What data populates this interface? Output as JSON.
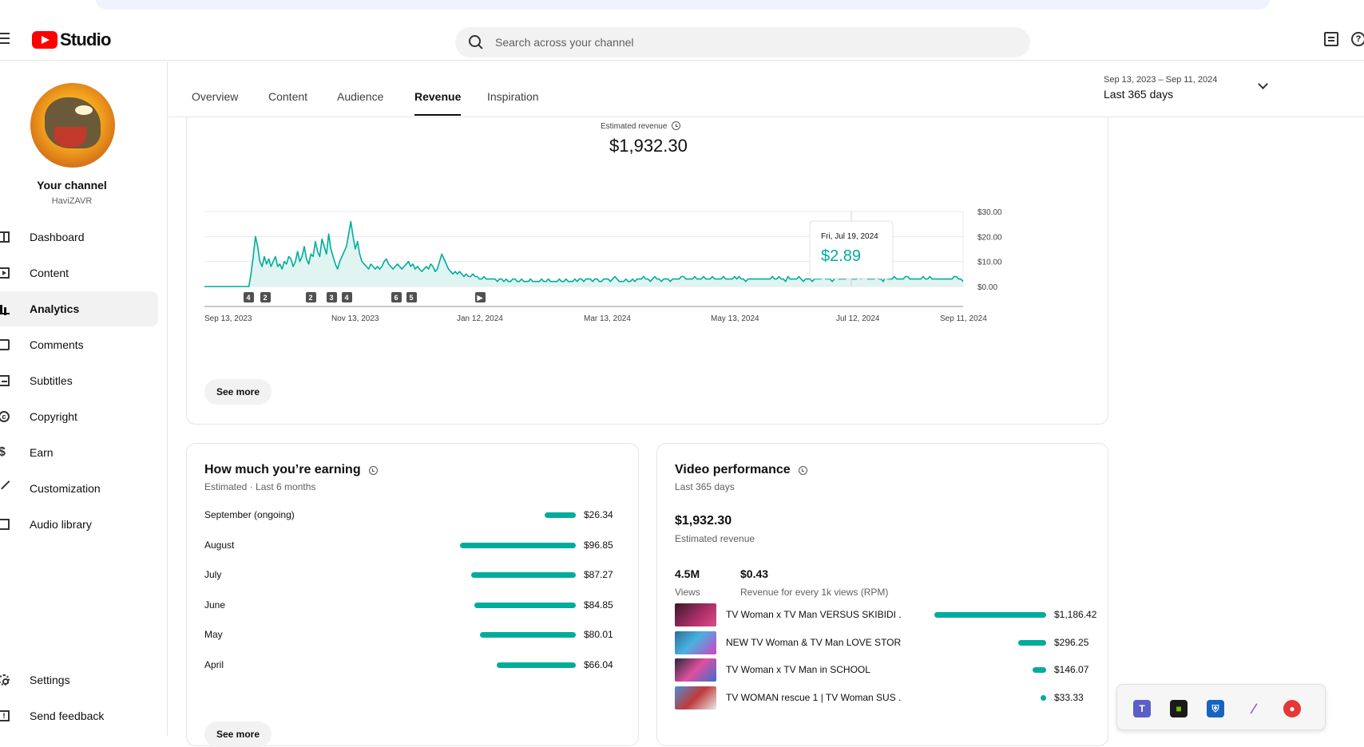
{
  "header": {
    "logo_text": "Studio",
    "search_placeholder": "Search across your channel"
  },
  "sidebar": {
    "channel_label": "Your channel",
    "channel_handle": "HaviZAVR",
    "items": [
      {
        "label": "Dashboard",
        "icon": "dashboard-icon"
      },
      {
        "label": "Content",
        "icon": "content-icon"
      },
      {
        "label": "Analytics",
        "icon": "analytics-icon",
        "active": true
      },
      {
        "label": "Comments",
        "icon": "comments-icon"
      },
      {
        "label": "Subtitles",
        "icon": "subtitles-icon"
      },
      {
        "label": "Copyright",
        "icon": "copyright-icon"
      },
      {
        "label": "Earn",
        "icon": "earn-icon"
      },
      {
        "label": "Customization",
        "icon": "customization-icon"
      },
      {
        "label": "Audio library",
        "icon": "audio-library-icon"
      }
    ],
    "bottom_items": [
      {
        "label": "Settings",
        "icon": "settings-icon"
      },
      {
        "label": "Send feedback",
        "icon": "feedback-icon"
      }
    ]
  },
  "tabs": [
    {
      "label": "Overview"
    },
    {
      "label": "Content"
    },
    {
      "label": "Audience"
    },
    {
      "label": "Revenue",
      "active": true
    },
    {
      "label": "Inspiration"
    }
  ],
  "date_range": {
    "range": "Sep 13, 2023 – Sep 11, 2024",
    "preset": "Last 365 days"
  },
  "revenue_card": {
    "label": "Estimated revenue",
    "value": "$1,932.30",
    "see_more": "See more",
    "tooltip_date": "Fri, Jul 19, 2024",
    "tooltip_value": "$2.89",
    "markers": [
      "4",
      "2",
      "2",
      "3",
      "4",
      "6",
      "5",
      "▶"
    ]
  },
  "chart_data": {
    "type": "area",
    "x_ticks": [
      "Sep 13, 2023",
      "Nov 13, 2023",
      "Jan 12, 2024",
      "Mar 13, 2024",
      "May 13, 2024",
      "Jul 12, 2024",
      "Sep 11, 2024"
    ],
    "y_ticks": [
      "$30.00",
      "$20.00",
      "$10.00",
      "$0.00"
    ],
    "ylim": [
      0,
      30
    ],
    "color": "#00ac9c",
    "values": [
      0,
      0,
      0,
      0,
      0,
      0,
      0,
      0,
      0,
      0,
      0,
      0,
      0,
      0,
      0,
      0,
      0,
      0,
      0,
      0,
      0,
      5,
      12,
      20,
      16,
      10,
      8,
      12,
      9,
      11,
      8,
      10,
      12,
      8,
      9,
      7,
      10,
      9,
      12,
      11,
      8,
      10,
      14,
      10,
      12,
      16,
      11,
      9,
      13,
      12,
      18,
      14,
      12,
      19,
      16,
      13,
      21,
      15,
      12,
      9,
      7,
      10,
      12,
      14,
      16,
      21,
      26,
      20,
      15,
      18,
      13,
      10,
      9,
      8,
      7,
      9,
      8,
      7,
      8,
      7,
      8,
      10,
      11,
      9,
      8,
      7,
      8,
      9,
      8,
      7,
      8,
      9,
      10,
      8,
      9,
      7,
      8,
      7,
      6,
      7,
      8,
      7,
      9,
      8,
      6,
      7,
      10,
      13,
      11,
      9,
      7,
      6,
      5,
      6,
      5,
      6,
      5,
      4,
      5,
      4,
      4,
      5,
      4,
      4,
      3,
      3,
      4,
      3,
      3,
      3,
      3,
      3,
      2,
      3,
      3,
      2,
      3,
      2,
      2,
      3,
      3,
      2,
      2,
      3,
      2,
      2,
      2,
      3,
      2,
      2,
      2,
      2,
      3,
      2,
      2,
      3,
      2,
      2,
      2,
      2,
      3,
      2,
      2,
      3,
      2,
      2,
      2,
      3,
      2,
      3,
      3,
      2,
      3,
      3,
      3,
      2,
      3,
      3,
      2,
      2,
      3,
      3,
      3,
      2,
      3,
      4,
      3,
      2,
      2,
      2,
      3,
      2,
      2,
      3,
      2,
      3,
      3,
      3,
      4,
      3,
      3,
      2,
      3,
      4,
      3,
      3,
      2,
      3,
      3,
      3,
      2,
      3,
      3,
      3,
      3,
      4,
      4,
      3,
      3,
      3,
      3,
      4,
      3,
      3,
      3,
      4,
      3,
      3,
      3,
      4,
      3,
      3,
      3,
      3,
      4,
      3,
      3,
      3,
      3,
      4,
      3,
      4,
      3,
      3,
      2,
      3,
      3,
      3,
      3,
      3,
      3,
      3,
      3,
      3,
      3,
      3,
      4,
      3,
      3,
      4,
      3,
      3,
      2,
      4,
      3,
      3,
      3,
      3,
      4,
      3,
      2,
      3,
      3,
      3,
      2,
      3,
      3,
      3,
      3,
      4,
      3,
      3,
      3,
      2,
      3,
      4,
      3,
      3,
      3,
      3,
      4,
      4,
      3,
      3,
      3,
      4,
      3,
      4,
      4,
      3,
      3,
      3,
      3,
      4,
      3,
      3,
      2,
      4,
      3,
      3,
      3,
      4,
      3,
      3,
      3,
      3,
      4,
      4,
      3,
      3,
      3,
      3,
      3,
      3,
      4,
      3,
      3,
      4,
      3,
      3,
      3,
      3,
      3,
      3,
      3,
      3,
      3,
      3,
      4,
      4,
      3,
      3,
      2
    ]
  },
  "earnings_card": {
    "title": "How much you’re earning",
    "subtitle": "Estimated · Last 6 months",
    "see_more": "See more",
    "max": 96.85,
    "rows": [
      {
        "month": "September (ongoing)",
        "value": "$26.34",
        "amount": 26.34
      },
      {
        "month": "August",
        "value": "$96.85",
        "amount": 96.85
      },
      {
        "month": "July",
        "value": "$87.27",
        "amount": 87.27
      },
      {
        "month": "June",
        "value": "$84.85",
        "amount": 84.85
      },
      {
        "month": "May",
        "value": "$80.01",
        "amount": 80.01
      },
      {
        "month": "April",
        "value": "$66.04",
        "amount": 66.04
      }
    ]
  },
  "video_card": {
    "title": "Video performance",
    "subtitle": "Last 365 days",
    "total": "$1,932.30",
    "total_label": "Estimated revenue",
    "views": "4.5M",
    "views_label": "Views",
    "rpm": "$0.43",
    "rpm_label": "Revenue for every 1k views (RPM)",
    "max": 1186.42,
    "videos": [
      {
        "title": "TV Woman x TV Man VERSUS SKIBIDI ...",
        "value": "$1,186.42",
        "amount": 1186.42
      },
      {
        "title": "NEW TV Woman & TV Man LOVE STOR...",
        "value": "$296.25",
        "amount": 296.25
      },
      {
        "title": "TV Woman x TV Man in SCHOOL",
        "value": "$146.07",
        "amount": 146.07
      },
      {
        "title": "TV WOMAN rescue 1 | TV Woman SUS ...",
        "value": "$33.33",
        "amount": 33.33
      }
    ]
  }
}
